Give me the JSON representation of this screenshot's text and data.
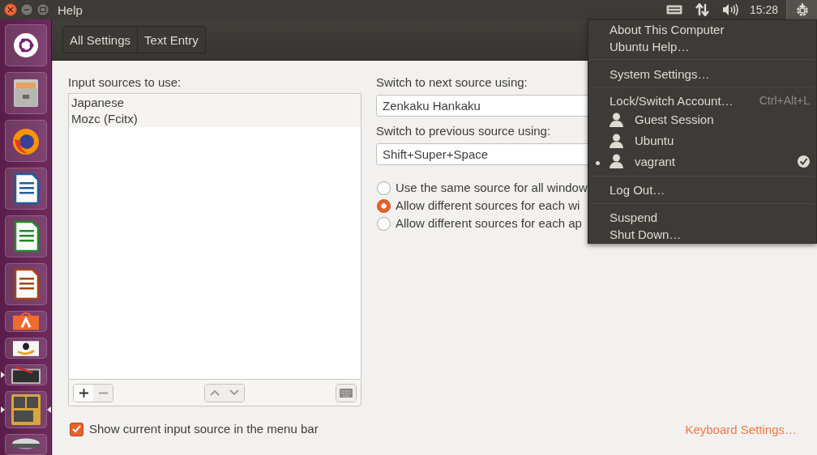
{
  "topbar": {
    "title": "Help",
    "clock": "15:28",
    "session_menu_open": true
  },
  "launcher": {
    "items": [
      {
        "kind": "dash",
        "running": false,
        "focused": false
      },
      {
        "kind": "files",
        "running": false,
        "focused": false
      },
      {
        "kind": "browser",
        "running": false,
        "focused": false
      },
      {
        "kind": "writer",
        "running": false,
        "focused": false
      },
      {
        "kind": "calc",
        "running": false,
        "focused": false
      },
      {
        "kind": "impress",
        "running": false,
        "focused": false
      },
      {
        "kind": "software",
        "running": false,
        "focused": false
      },
      {
        "kind": "amazon",
        "running": false,
        "focused": false
      },
      {
        "kind": "settings",
        "running": true,
        "focused": false
      },
      {
        "kind": "workspaces",
        "running": true,
        "focused": true
      },
      {
        "kind": "drive",
        "running": false,
        "focused": false
      }
    ]
  },
  "breadcrumbs": [
    "All Settings",
    "Text Entry"
  ],
  "input_sources": {
    "label": "Input sources to use:",
    "items": [
      "Japanese",
      "Mozc (Fcitx)"
    ]
  },
  "switch_next": {
    "label": "Switch to next source using:",
    "value": "Zenkaku Hankaku"
  },
  "switch_previous": {
    "label": "Switch to previous source using:",
    "value": "Shift+Super+Space"
  },
  "radios": [
    {
      "label": "Use the same source for all window",
      "selected": false
    },
    {
      "label": "Allow different sources for each wi",
      "selected": true
    },
    {
      "label": "Allow different sources for each ap",
      "selected": false
    }
  ],
  "show_indicator": {
    "label": "Show current input source in the menu bar",
    "checked": true
  },
  "keyboard_settings_link": "Keyboard Settings…",
  "session_menu": {
    "items": [
      {
        "kind": "item",
        "label": "About This Computer"
      },
      {
        "kind": "item",
        "label": "Ubuntu Help…"
      },
      {
        "kind": "separator"
      },
      {
        "kind": "item",
        "label": "System Settings…"
      },
      {
        "kind": "separator"
      },
      {
        "kind": "item",
        "label": "Lock/Switch Account…",
        "shortcut": "Ctrl+Alt+L"
      },
      {
        "kind": "user",
        "label": "Guest Session",
        "logged_in": false,
        "current": false
      },
      {
        "kind": "user",
        "label": "Ubuntu",
        "logged_in": false,
        "current": false
      },
      {
        "kind": "user",
        "label": "vagrant",
        "logged_in": true,
        "current": true
      },
      {
        "kind": "separator"
      },
      {
        "kind": "item",
        "label": "Log Out…"
      },
      {
        "kind": "separator"
      },
      {
        "kind": "item",
        "label": "Suspend"
      },
      {
        "kind": "item",
        "label": "Shut Down…"
      }
    ]
  }
}
